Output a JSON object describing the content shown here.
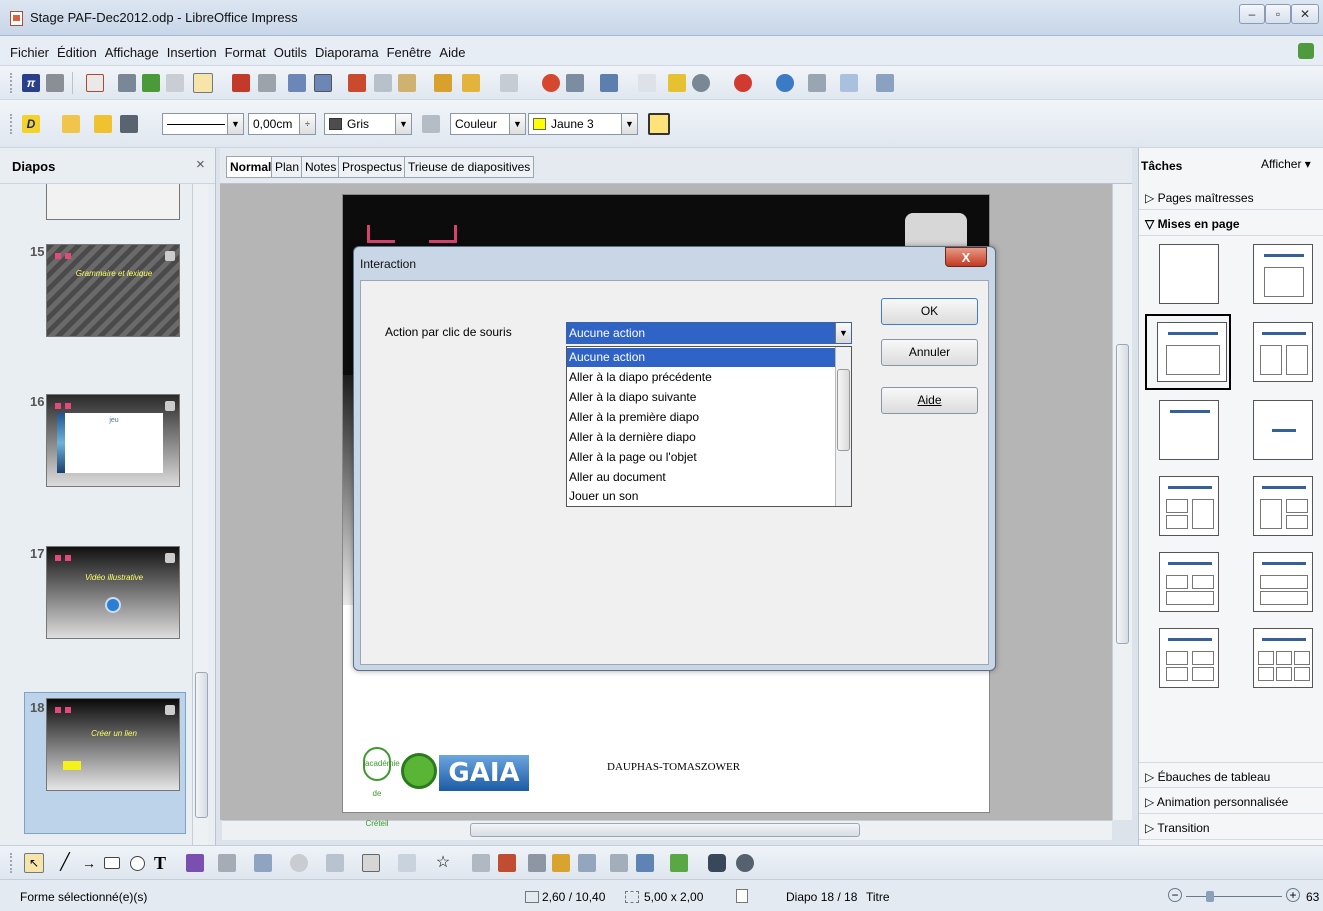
{
  "window": {
    "title": "Stage PAF-Dec2012.odp - LibreOffice Impress"
  },
  "menu": [
    "Fichier",
    "Édition",
    "Affichage",
    "Insertion",
    "Format",
    "Outils",
    "Diaporama",
    "Fenêtre",
    "Aide"
  ],
  "line_toolbar": {
    "width_value": "0,00cm",
    "area_color": "Gris",
    "fill_type": "Couleur",
    "fill_color": "Jaune 3"
  },
  "colors": {
    "area_swatch": "#4d4d4d",
    "fill_swatch": "#ffff00"
  },
  "slides_panel": {
    "title": "Diapos",
    "close": "×",
    "slides": [
      {
        "number": "15",
        "title": "Grammaire et lexique"
      },
      {
        "number": "16",
        "title": "jeu"
      },
      {
        "number": "17",
        "title": "Vidéo illustrative"
      },
      {
        "number": "18",
        "title": "Créer un lien",
        "selected": true
      }
    ]
  },
  "view_tabs": [
    "Normal",
    "Plan",
    "Notes",
    "Prospectus",
    "Trieuse de diapositives"
  ],
  "slide": {
    "footer_text": "DAUPHAS-TOMASZOWER",
    "logo_text": "GAIA",
    "academie_text": "académie de Créteil"
  },
  "dialog": {
    "title": "Interaction",
    "close": "X",
    "action_label": "Action par clic de souris",
    "selected_action": "Aucune action",
    "options": [
      "Aucune action",
      "Aller à la diapo précédente",
      "Aller à la diapo suivante",
      "Aller à la première diapo",
      "Aller à la dernière diapo",
      "Aller à la page ou l'objet",
      "Aller au document",
      "Jouer un son"
    ],
    "buttons": {
      "ok": "OK",
      "cancel": "Annuler",
      "help": "Aide"
    }
  },
  "task_panel": {
    "title": "Tâches",
    "view_menu": "Afficher",
    "sections": {
      "master_pages": "Pages maîtresses",
      "layouts": "Mises en page",
      "table_design": "Ébauches de tableau",
      "custom_animation": "Animation personnalisée",
      "transition": "Transition"
    }
  },
  "status": {
    "selection": "Forme sélectionné(e)(s)",
    "position": "2,60 / 10,40",
    "size": "5,00 x 2,00",
    "slide": "Diapo 18 / 18",
    "layout": "Titre",
    "zoom": "63"
  }
}
